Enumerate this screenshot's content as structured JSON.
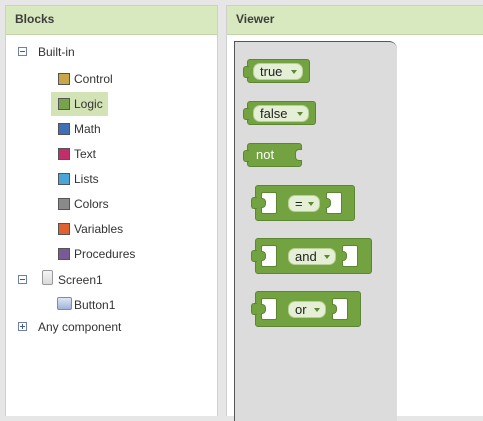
{
  "blocks_panel": {
    "title": "Blocks",
    "builtin_label": "Built-in",
    "items": [
      {
        "label": "Control",
        "color": "#c7a74a"
      },
      {
        "label": "Logic",
        "color": "#77a34a"
      },
      {
        "label": "Math",
        "color": "#3f6fb5"
      },
      {
        "label": "Text",
        "color": "#c22d6a"
      },
      {
        "label": "Lists",
        "color": "#4aa6d9"
      },
      {
        "label": "Colors",
        "color": "#8a8a8a"
      },
      {
        "label": "Variables",
        "color": "#e06030"
      },
      {
        "label": "Procedures",
        "color": "#7a5a96"
      }
    ],
    "selected_item": "Logic",
    "screen_label": "Screen1",
    "button_label": "Button1",
    "any_component_label": "Any component"
  },
  "viewer": {
    "title": "Viewer",
    "blocks": {
      "true_label": "true",
      "false_label": "false",
      "not_label": "not",
      "equals_label": "=",
      "and_label": "and",
      "or_label": "or"
    },
    "block_color": "#73a340"
  }
}
